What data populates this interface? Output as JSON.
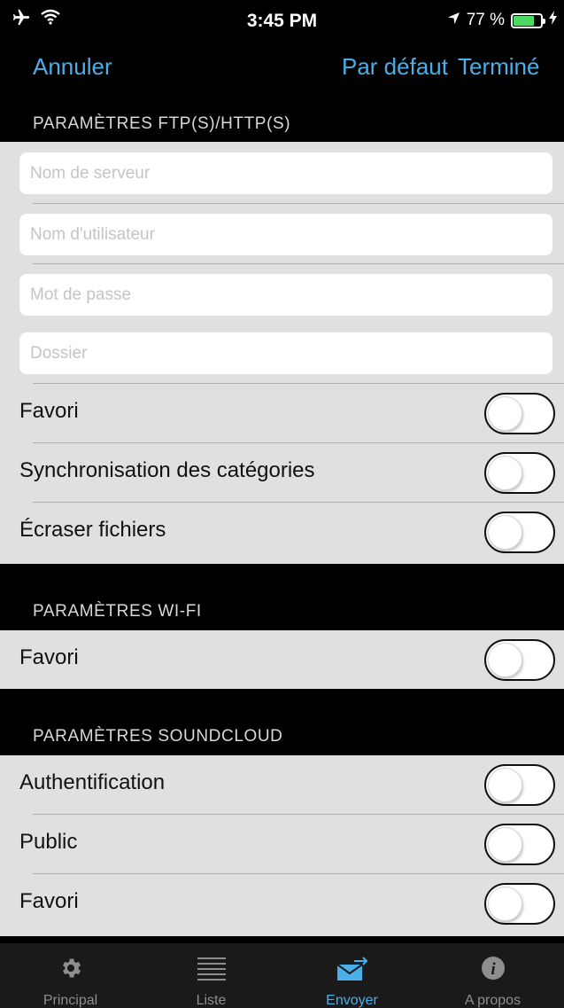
{
  "status_bar": {
    "time": "3:45 PM",
    "battery_text": "77 %",
    "battery_level": 0.77,
    "icons": [
      "airplane-icon",
      "wifi-icon",
      "location-arrow-icon",
      "battery-icon",
      "charging-icon"
    ]
  },
  "nav": {
    "cancel_label": "Annuler",
    "default_label": "Par défaut",
    "done_label": "Terminé"
  },
  "ftp": {
    "header": "PARAMÈTRES FTP(S)/HTTP(S)",
    "server_placeholder": "Nom de serveur",
    "user_placeholder": "Nom d'utilisateur",
    "password_placeholder": "Mot de passe",
    "folder_placeholder": "Dossier",
    "rows": [
      {
        "label": "Favori",
        "on": false
      },
      {
        "label": "Synchronisation des catégories",
        "on": false
      },
      {
        "label": "Écraser fichiers",
        "on": false
      }
    ]
  },
  "wifi": {
    "header": "PARAMÈTRES WI-FI",
    "rows": [
      {
        "label": "Favori",
        "on": false
      }
    ]
  },
  "soundcloud": {
    "header": "PARAMÈTRES SOUNDCLOUD",
    "rows": [
      {
        "label": "Authentification",
        "on": false
      },
      {
        "label": "Public",
        "on": false
      },
      {
        "label": "Favori",
        "on": false
      }
    ]
  },
  "tabs": [
    {
      "label": "Principal",
      "icon": "gear-icon",
      "active": false
    },
    {
      "label": "Liste",
      "icon": "list-icon",
      "active": false
    },
    {
      "label": "Envoyer",
      "icon": "send-mail-icon",
      "active": true
    },
    {
      "label": "A propos",
      "icon": "info-icon",
      "active": false
    }
  ],
  "colors": {
    "accent": "#4aaee8",
    "background": "#000000",
    "section": "#e0e0e0",
    "battery": "#4cd964",
    "tab_inactive": "#8e8e8e"
  }
}
